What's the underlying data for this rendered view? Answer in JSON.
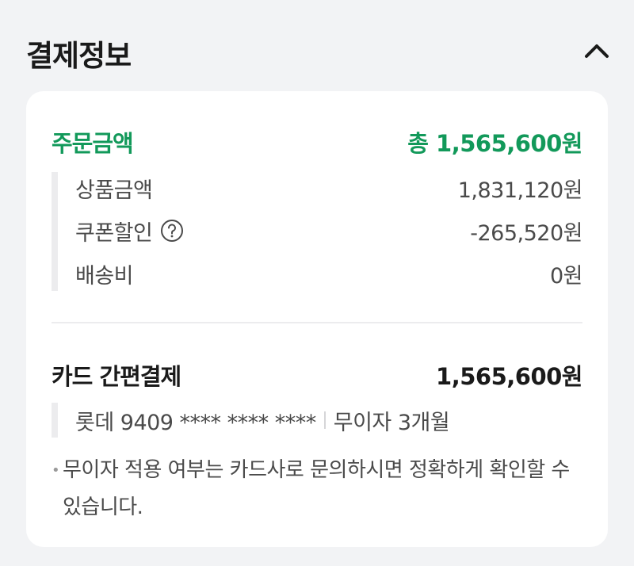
{
  "header": {
    "title": "결제정보"
  },
  "order": {
    "label": "주문금액",
    "total": "총 1,565,600원",
    "accent_color": "#12995a",
    "items": [
      {
        "label": "상품금액",
        "value": "1,831,120원"
      },
      {
        "label": "쿠폰할인",
        "value": "-265,520원"
      },
      {
        "label": "배송비",
        "value": "0원"
      }
    ]
  },
  "payment": {
    "method": "카드 간편결제",
    "amount": "1,565,600원",
    "card": "롯데 9409 **** **** ****",
    "installment": "무이자 3개월",
    "notice": "무이자 적용 여부는 카드사로 문의하시면 정확하게 확인할 수 있습니다."
  },
  "icons": {
    "collapse": "chevron-up-icon",
    "help": "question-circle-icon"
  }
}
